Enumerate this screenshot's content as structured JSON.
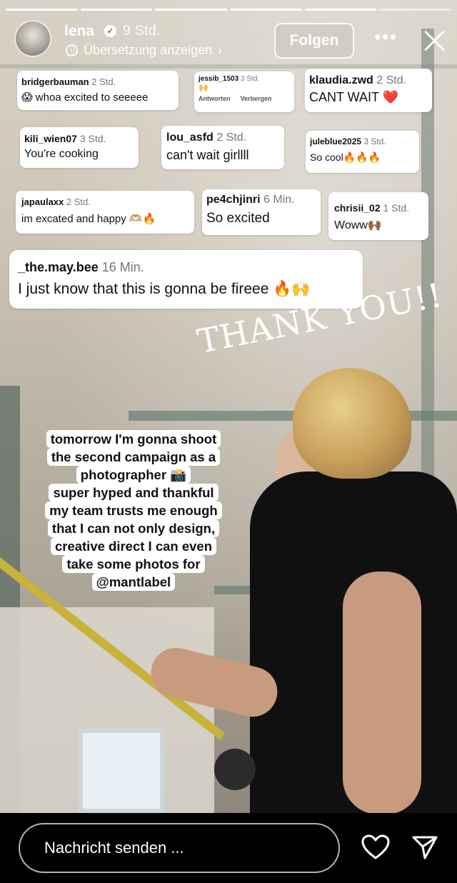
{
  "header": {
    "username": "lena",
    "time": "9 Std.",
    "translate_label": "Übersetzung anzeigen",
    "follow_label": "Folgen",
    "more_label": "•••"
  },
  "comments": [
    {
      "user": "bridgerbauman",
      "time": "2 Std.",
      "text": "😱 whoa excited to seeeee"
    },
    {
      "user": "jessib_1503",
      "time": "3 Std.",
      "text": "🙌",
      "actions": [
        "Antworten",
        "Verbergen"
      ]
    },
    {
      "user": "klaudia.zwd",
      "time": "2 Std.",
      "text": "CANT WAIT ❤️"
    },
    {
      "user": "kili_wien07",
      "time": "3 Std.",
      "text": "You're cooking"
    },
    {
      "user": "lou_asfd",
      "time": "2 Std.",
      "text": "can't wait girllll"
    },
    {
      "user": "juleblue2025",
      "time": "3 Std.",
      "text": "So cool🔥🔥🔥"
    },
    {
      "user": "japaulaxx",
      "time": "2 Std.",
      "text": "im excated  and happy 🫶🏼🔥"
    },
    {
      "user": "pe4chjinri",
      "time": "6 Min.",
      "text": "So excited"
    },
    {
      "user": "chrisii_02",
      "time": "1 Std.",
      "text": "Woww🙌🏾"
    },
    {
      "user": "_the.may.bee",
      "time": "16 Min.",
      "text": "I just know that this is gonna be fireee 🔥🙌"
    }
  ],
  "thanks_text": "THANK YOU!!",
  "caption_lines": [
    "tomorrow I'm gonna shoot",
    "the second campaign as a",
    "photographer 📸",
    "super hyped and thankful",
    "my team trusts me enough",
    "that I can not only design,",
    "creative direct I can even",
    "take some photos for",
    "@mantlabel"
  ],
  "footer": {
    "message_placeholder": "Nachricht senden ...",
    "icons": [
      "heart-icon",
      "send-icon"
    ]
  }
}
